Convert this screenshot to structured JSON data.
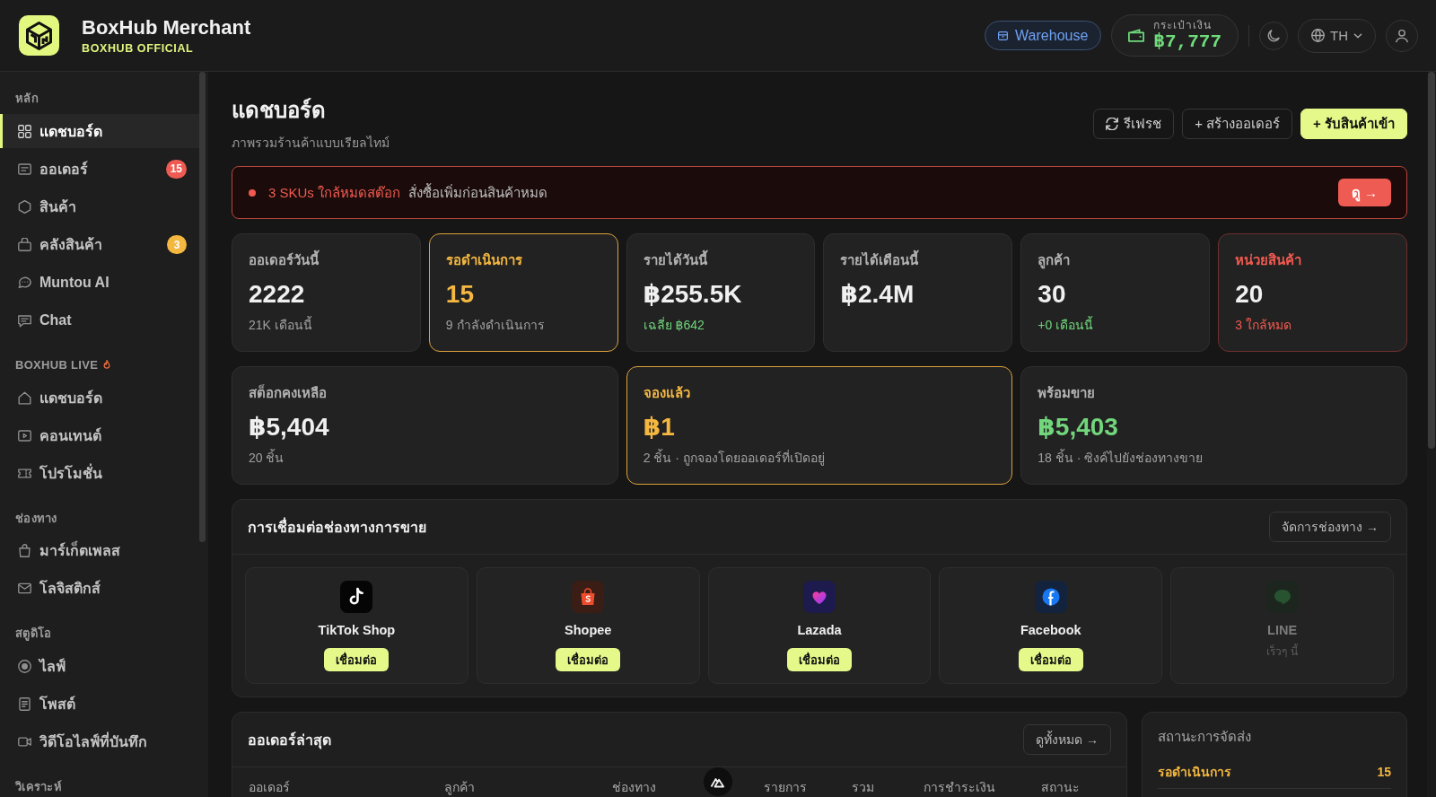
{
  "header": {
    "brand_name": "BoxHub Merchant",
    "brand_subtitle": "BOXHUB OFFICIAL",
    "warehouse_button": "Warehouse",
    "wallet": {
      "label": "กระเป๋าเงิน",
      "amount": "฿7,777"
    },
    "language_button": "TH"
  },
  "sidebar": {
    "sections": [
      {
        "title": "หลัก",
        "hot": false,
        "items": [
          {
            "label": "แดชบอร์ด",
            "selected": true
          },
          {
            "label": "ออเดอร์",
            "selected": false,
            "badge": {
              "text": "15",
              "color": "#ef5b52"
            }
          },
          {
            "label": "สินค้า",
            "selected": false
          },
          {
            "label": "คลังสินค้า",
            "selected": false,
            "badge": {
              "text": "3",
              "color": "#f4b740"
            }
          },
          {
            "label": "Muntou AI",
            "selected": false
          },
          {
            "label": "Chat",
            "selected": false
          }
        ]
      },
      {
        "title": "BOXHUB LIVE",
        "hot": true,
        "items": [
          {
            "label": "แดชบอร์ด",
            "selected": false
          },
          {
            "label": "คอนเทนต์",
            "selected": false
          },
          {
            "label": "โปรโมชั่น",
            "selected": false
          }
        ]
      },
      {
        "title": "ช่องทาง",
        "hot": false,
        "items": [
          {
            "label": "มาร์เก็ตเพลส",
            "selected": false
          },
          {
            "label": "โลจิสติกส์",
            "selected": false
          }
        ]
      },
      {
        "title": "สตูดิโอ",
        "hot": false,
        "items": [
          {
            "label": "ไลฟ์",
            "selected": false
          },
          {
            "label": "โพสต์",
            "selected": false
          },
          {
            "label": "วิดีโอไลฟ์ที่บันทึก",
            "selected": false
          }
        ]
      },
      {
        "title": "วิเคราะห์",
        "hot": false
      }
    ]
  },
  "page": {
    "title": "แดชบอร์ด",
    "subtitle": "ภาพรวมร้านค้าแบบเรียลไทม์",
    "actions": [
      {
        "label": "รีเฟรช",
        "kind": "refresh"
      },
      {
        "label": "+ สร้างออเดอร์",
        "kind": "secondary"
      },
      {
        "label": "+ รับสินค้าเข้า",
        "kind": "primary"
      }
    ]
  },
  "alert": {
    "highlight": "3 SKUs ใกล้หมดสต๊อก",
    "message": "สั่งซื้อเพิ่มก่อนสินค้าหมด",
    "button": "ดู →"
  },
  "stats": [
    {
      "kind": "default",
      "label": "ออเดอร์วันนี้",
      "value": "2222",
      "note": {
        "text": "21K เดือนนี้",
        "kind": "muted"
      }
    },
    {
      "kind": "warning",
      "label": "รอดำเนินการ",
      "value": "15",
      "note": {
        "text": "9 กำลังดำเนินการ",
        "kind": "muted"
      }
    },
    {
      "kind": "default",
      "label": "รายได้วันนี้",
      "value": "฿255.5K",
      "note": {
        "text": "เฉลี่ย ฿642",
        "kind": "positive"
      }
    },
    {
      "kind": "default",
      "label": "รายได้เดือนนี้",
      "value": "฿2.4M"
    },
    {
      "kind": "default",
      "label": "ลูกค้า",
      "value": "30",
      "note": {
        "text": "+0 เดือนนี้",
        "kind": "positive"
      }
    },
    {
      "kind": "danger",
      "label": "หน่วยสินค้า",
      "value": "20",
      "note": {
        "text": "3 ใกล้หมด",
        "kind": "negative"
      }
    }
  ],
  "stock_stats": [
    {
      "kind": "default",
      "label": "สต็อกคงเหลือ",
      "value": "฿5,404",
      "note": {
        "text": "20 ชิ้น",
        "kind": "muted"
      }
    },
    {
      "kind": "warning",
      "label": "จองแล้ว",
      "value": "฿1",
      "note": {
        "text": "2 ชิ้น · ถูกจองโดยออเดอร์ที่เปิดอยู่",
        "kind": "muted"
      }
    },
    {
      "kind": "success",
      "label": "พร้อมขาย",
      "value": "฿5,403",
      "note": {
        "text": "18 ชิ้น · ซิงค์ไปยังช่องทางขาย",
        "kind": "muted"
      }
    }
  ],
  "channels": {
    "title": "การเชื่อมต่อช่องทางการขาย",
    "button": "จัดการช่องทาง →",
    "items": [
      {
        "name": "TikTok Shop",
        "disabled": false,
        "button": "เชื่อมต่อ"
      },
      {
        "name": "Shopee",
        "disabled": false,
        "button": "เชื่อมต่อ"
      },
      {
        "name": "Lazada",
        "disabled": false,
        "button": "เชื่อมต่อ"
      },
      {
        "name": "Facebook",
        "disabled": false,
        "button": "เชื่อมต่อ"
      },
      {
        "name": "LINE",
        "disabled": true,
        "note": "เร็วๆ นี้"
      }
    ]
  },
  "recent_orders": {
    "title": "ออเดอร์ล่าสุด",
    "button": "ดูทั้งหมด →",
    "columns": [
      "ออเดอร์",
      "ลูกค้า",
      "ช่องทาง",
      "รายการ",
      "รวม",
      "การชำระเงิน",
      "สถานะ"
    ]
  },
  "shipping_status": {
    "title": "สถานะการจัดส่ง",
    "rows": [
      {
        "label": "รอดำเนินการ",
        "count": "15",
        "color": "#f4b740"
      }
    ]
  }
}
